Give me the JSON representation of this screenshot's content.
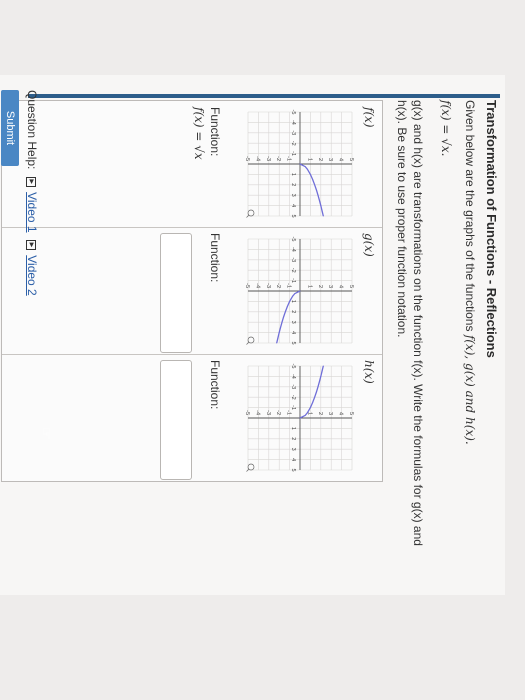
{
  "heading": {
    "title": "Transformation of Functions - Reflections",
    "intro_text": "Given below are the graphs of the functions",
    "intro_fns": "f(x), g(x) and h(x).",
    "base_function": "f(x) = √x.",
    "instructions_line1": "g(x) and h(x) are transformations on the function f(x). Write the formulas for g(x) and",
    "instructions_line2": "h(x). Be sure to use proper function notation."
  },
  "graph_axis": {
    "x_ticks": [
      "-5",
      "-4",
      "-3",
      "-2",
      "-1",
      "1",
      "2",
      "3",
      "4",
      "5"
    ],
    "y_ticks": [
      "5",
      "4",
      "3",
      "2",
      "1",
      "-1",
      "-2",
      "-3",
      "-4",
      "-5"
    ]
  },
  "graphs": [
    {
      "label": "f(x)",
      "function_label": "Function:",
      "function_value": "f(x) = √x",
      "chart_data": {
        "type": "line",
        "title": "f(x)",
        "xlim": [
          -5,
          5
        ],
        "ylim": [
          -5,
          5
        ],
        "x": [
          0,
          0.25,
          0.5,
          1,
          1.5,
          2,
          2.5,
          3,
          3.5,
          4,
          4.5,
          5
        ],
        "y": [
          0,
          0.5,
          0.71,
          1,
          1.22,
          1.41,
          1.58,
          1.73,
          1.87,
          2,
          2.12,
          2.24
        ],
        "grid": true,
        "color": "#6f6ed8"
      }
    },
    {
      "label": "g(x)",
      "function_label": "Function:",
      "function_value": "",
      "chart_data": {
        "type": "line",
        "title": "g(x)",
        "xlim": [
          -5,
          5
        ],
        "ylim": [
          -5,
          5
        ],
        "x": [
          0,
          0.25,
          0.5,
          1,
          1.5,
          2,
          2.5,
          3,
          3.5,
          4,
          4.5,
          5
        ],
        "y": [
          0,
          -0.5,
          -0.71,
          -1,
          -1.22,
          -1.41,
          -1.58,
          -1.73,
          -1.87,
          -2,
          -2.12,
          -2.24
        ],
        "grid": true,
        "color": "#6f6ed8"
      }
    },
    {
      "label": "h(x)",
      "function_label": "Function:",
      "function_value": "",
      "chart_data": {
        "type": "line",
        "title": "h(x)",
        "xlim": [
          -5,
          5
        ],
        "ylim": [
          -5,
          5
        ],
        "x": [
          -5,
          -4.5,
          -4,
          -3.5,
          -3,
          -2.5,
          -2,
          -1.5,
          -1,
          -0.5,
          -0.25,
          0
        ],
        "y": [
          2.24,
          2.12,
          2,
          1.87,
          1.73,
          1.58,
          1.41,
          1.22,
          1,
          0.71,
          0.5,
          0
        ],
        "grid": true,
        "color": "#6f6ed8"
      }
    }
  ],
  "footer": {
    "help_label": "Question Help:",
    "video1": "Video 1",
    "video2": "Video 2",
    "submit_label": "Submit Question"
  }
}
